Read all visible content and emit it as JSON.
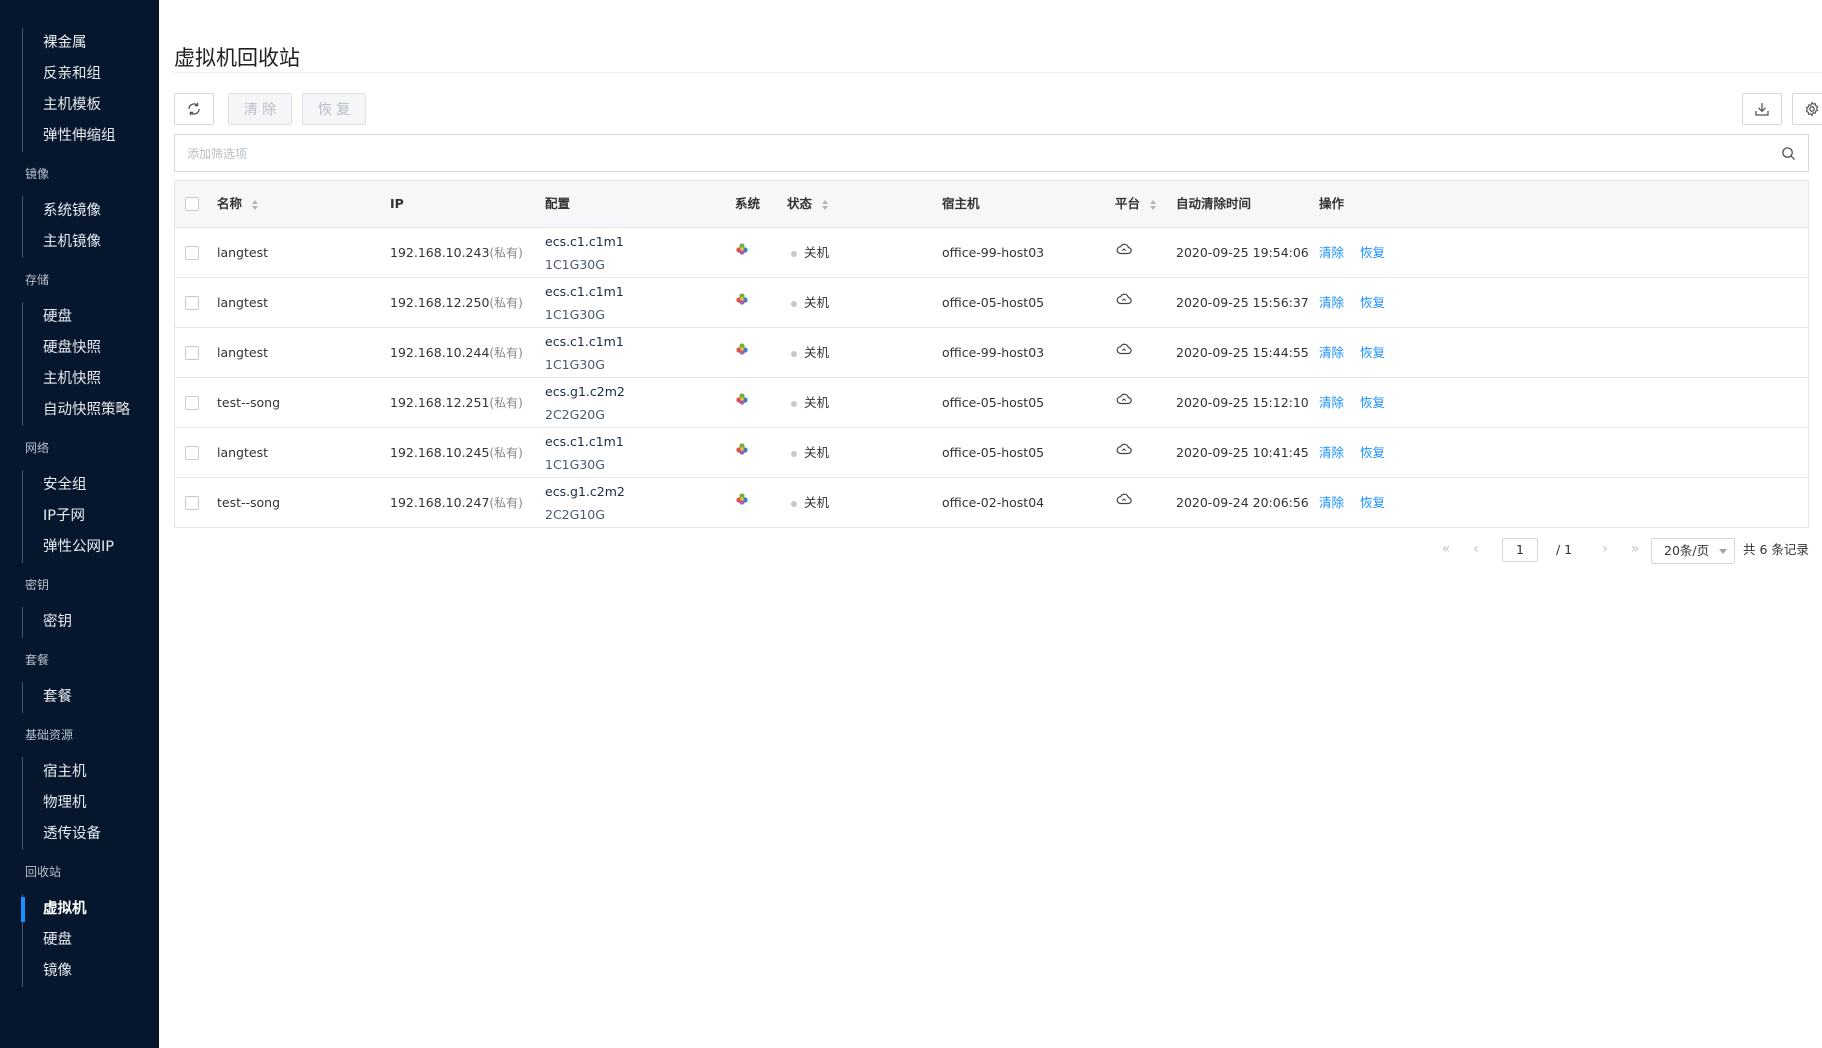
{
  "sidebar": {
    "groups": [
      {
        "title": "",
        "items": [
          "裸金属",
          "反亲和组",
          "主机模板",
          "弹性伸缩组"
        ]
      },
      {
        "title": "镜像",
        "items": [
          "系统镜像",
          "主机镜像"
        ]
      },
      {
        "title": "存储",
        "items": [
          "硬盘",
          "硬盘快照",
          "主机快照",
          "自动快照策略"
        ]
      },
      {
        "title": "网络",
        "items": [
          "安全组",
          "IP子网",
          "弹性公网IP"
        ]
      },
      {
        "title": "密钥",
        "items": [
          "密钥"
        ]
      },
      {
        "title": "套餐",
        "items": [
          "套餐"
        ]
      },
      {
        "title": "基础资源",
        "items": [
          "宿主机",
          "物理机",
          "透传设备"
        ]
      },
      {
        "title": "回收站",
        "items": [
          "虚拟机",
          "硬盘",
          "镜像"
        ]
      }
    ],
    "active_item": "虚拟机"
  },
  "page": {
    "title": "虚拟机回收站"
  },
  "toolbar": {
    "refresh_icon": "refresh-icon",
    "clear_label": "清 除",
    "restore_label": "恢 复",
    "download_icon": "download-icon",
    "settings_icon": "gear-icon"
  },
  "filter": {
    "placeholder": "添加筛选项"
  },
  "table": {
    "columns": {
      "name": "名称",
      "ip": "IP",
      "config": "配置",
      "os": "系统",
      "status": "状态",
      "host": "宿主机",
      "platform": "平台",
      "auto_clear_time": "自动清除时间",
      "actions": "操作"
    },
    "rows": [
      {
        "name": "langtest",
        "ip": "192.168.10.243",
        "ip_type": "(私有)",
        "spec": "ecs.c1.c1m1",
        "size": "1C1G30G",
        "status": "关机",
        "host": "office-99-host03",
        "time": "2020-09-25 19:54:06"
      },
      {
        "name": "langtest",
        "ip": "192.168.12.250",
        "ip_type": "(私有)",
        "spec": "ecs.c1.c1m1",
        "size": "1C1G30G",
        "status": "关机",
        "host": "office-05-host05",
        "time": "2020-09-25 15:56:37"
      },
      {
        "name": "langtest",
        "ip": "192.168.10.244",
        "ip_type": "(私有)",
        "spec": "ecs.c1.c1m1",
        "size": "1C1G30G",
        "status": "关机",
        "host": "office-99-host03",
        "time": "2020-09-25 15:44:55"
      },
      {
        "name": "test--song",
        "ip": "192.168.12.251",
        "ip_type": "(私有)",
        "spec": "ecs.g1.c2m2",
        "size": "2C2G20G",
        "status": "关机",
        "host": "office-05-host05",
        "time": "2020-09-25 15:12:10"
      },
      {
        "name": "langtest",
        "ip": "192.168.10.245",
        "ip_type": "(私有)",
        "spec": "ecs.c1.c1m1",
        "size": "1C1G30G",
        "status": "关机",
        "host": "office-05-host05",
        "time": "2020-09-25 10:41:45"
      },
      {
        "name": "test--song",
        "ip": "192.168.10.247",
        "ip_type": "(私有)",
        "spec": "ecs.g1.c2m2",
        "size": "2C2G10G",
        "status": "关机",
        "host": "office-02-host04",
        "time": "2020-09-24 20:06:56"
      }
    ],
    "action_clear": "清除",
    "action_restore": "恢复"
  },
  "pagination": {
    "current_page": "1",
    "total_pages": "/ 1",
    "page_size": "20条/页",
    "total_records": "共 6 条记录"
  },
  "colors": {
    "sidebar_bg": "#06172d",
    "accent": "#1890ff",
    "link": "#1890ff"
  }
}
